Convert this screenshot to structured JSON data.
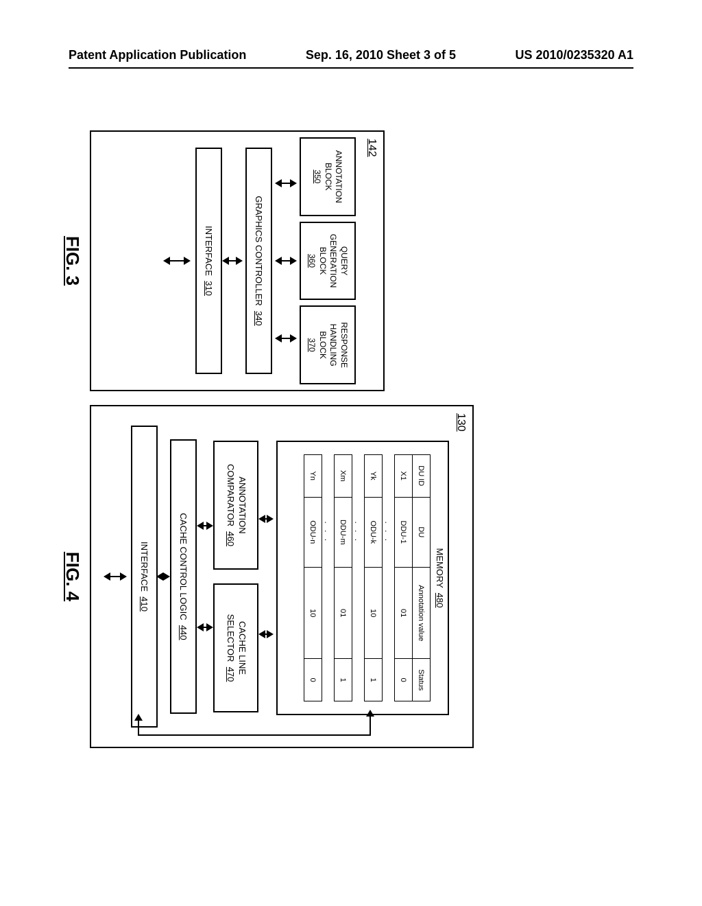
{
  "header": {
    "left": "Patent Application Publication",
    "center": "Sep. 16, 2010  Sheet 3 of 5",
    "right": "US 2010/0235320 A1"
  },
  "fig3": {
    "ref": "142",
    "annotation_block": "ANNOTATION\nBLOCK",
    "annotation_block_num": "350",
    "query_block": "QUERY\nGENERATION\nBLOCK",
    "query_block_num": "360",
    "response_block": "RESPONSE\nHANDLING\nBLOCK",
    "response_block_num": "370",
    "controller": "GRAPHICS CONTROLLER",
    "controller_num": "340",
    "interface": "INTERFACE",
    "interface_num": "310",
    "label": "FIG. 3"
  },
  "fig4": {
    "ref": "130",
    "memory_label": "MEMORY",
    "memory_num": "480",
    "table": {
      "headers": [
        "DU ID",
        "DU",
        "Annotation value",
        "Status"
      ],
      "rows": [
        [
          "X1",
          "DDU-1",
          "01",
          "0"
        ],
        [
          "Yk",
          "ODU-k",
          "10",
          "1"
        ],
        [
          "Xm",
          "DDU-m",
          "01",
          "1"
        ],
        [
          "Yn",
          "ODU-n",
          "10",
          "0"
        ]
      ]
    },
    "annot_comp": "ANNOTATION\nCOMPARATOR",
    "annot_comp_num": "460",
    "cache_sel": "CACHE LINE\nSELECTOR",
    "cache_sel_num": "470",
    "cache_ctrl": "CACHE CONTROL LOGIC",
    "cache_ctrl_num": "440",
    "interface": "INTERFACE",
    "interface_num": "410",
    "label": "FIG. 4"
  }
}
